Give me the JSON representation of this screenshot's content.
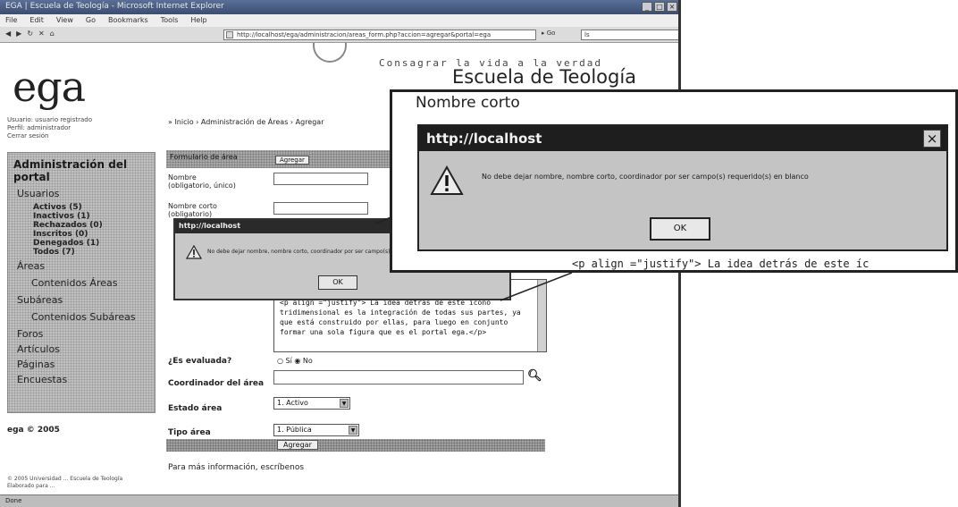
{
  "window": {
    "title": "EGA | Escuela de Teología - Microsoft Internet Explorer",
    "buttons": [
      "_",
      "□",
      "×"
    ]
  },
  "menubar": [
    "File",
    "Edit",
    "View",
    "Go",
    "Bookmarks",
    "Tools",
    "Help"
  ],
  "toolbar": {
    "address": "http://localhost/ega/administracion/areas_form.php?accion=agregar&portal=ega",
    "go_label": "Go",
    "search_placeholder": "ls"
  },
  "header": {
    "logo": "ega",
    "motto": "Consagrar la vida a la verdad",
    "school": "Escuela de Teología"
  },
  "user_info": [
    "Usuario: usuario registrado",
    "Perfil: administrador",
    "Cerrar sesión"
  ],
  "breadcrumb": "» Inicio › Administración de Áreas › Agregar",
  "sidebar": {
    "title": "Administración del portal",
    "usuarios": "Usuarios",
    "user_counts": [
      "Activos (5)",
      "Inactivos (1)",
      "Rechazados (0)",
      "Inscritos (0)",
      "Denegados (1)",
      "Todos (7)"
    ],
    "areas": "Áreas",
    "contenidos_areas": "Contenidos Áreas",
    "subareas": "Subáreas",
    "contenidos_subareas": "Contenidos Subáreas",
    "foros": "Foros",
    "articulos": "Artículos",
    "paginas": "Páginas",
    "encuestas": "Encuestas"
  },
  "footer_left": "ega © 2005",
  "form": {
    "header_label": "Formulario de área",
    "header_button": "Agregar",
    "nombre_label": "Nombre",
    "nombre_hint": "(obligatorio, único)",
    "nombre_corto_label": "Nombre corto",
    "nombre_corto_hint": "(obligatorio)",
    "descripcion_text": "<p align =\"justify\"> La idea detrás de este ícono tridimensional es la integración de todas sus partes, ya que está construido por ellas, para luego en conjunto formar una sola figura que es el portal ega.</p>",
    "evaluada_label": "¿Es evaluada?",
    "evaluada_si": "Sí",
    "evaluada_no": "No",
    "coordinador_label": "Coordinador del área",
    "estado_label": "Estado área",
    "estado_value": "1. Activo",
    "tipo_label": "Tipo área",
    "tipo_value": "1. Pública",
    "submit": "Agregar"
  },
  "more_info": "Para más información, escríbenos",
  "copyright": [
    "© 2005 Universidad ... Escuela de Teología",
    "Elaborado para ..."
  ],
  "statusbar": "Done",
  "dialog_small": {
    "title": "http://localhost",
    "message": "No debe dejar nombre, nombre corto, coordinador por ser campo(s) requerido(s) en blanco",
    "ok": "OK"
  },
  "callout": {
    "nombre_corto": "Nombre corto",
    "dialog_title": "http://localhost",
    "close": "×",
    "message": "No debe dejar nombre, nombre corto, coordinador por ser campo(s) requerido(s) en blanco",
    "ok": "OK",
    "code_line": "<p align =\"justify\"> La idea detrás de este íc"
  }
}
